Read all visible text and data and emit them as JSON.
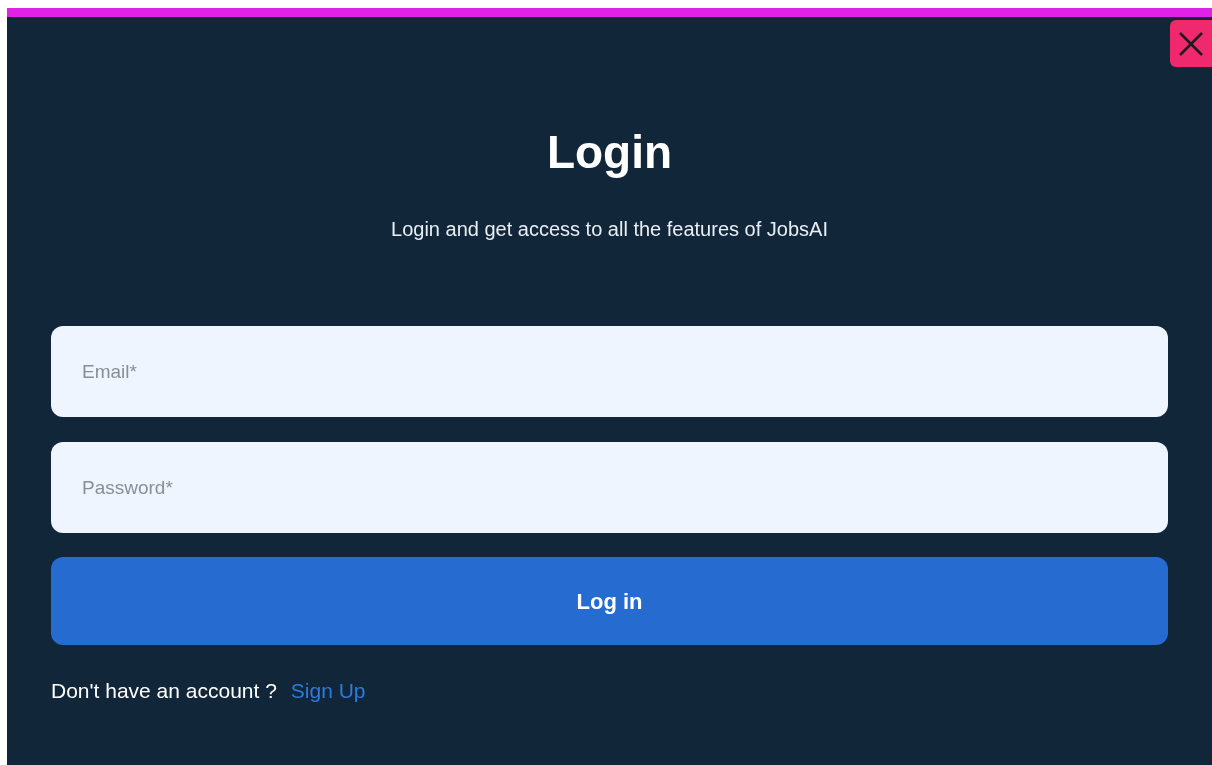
{
  "dialog": {
    "title": "Login",
    "subtitle": "Login and get access to all the features of JobsAI"
  },
  "fields": [
    {
      "placeholder": "Email*"
    },
    {
      "placeholder": "Password*"
    }
  ],
  "submit": "Log in",
  "footer": {
    "text": "Don't have an account ?",
    "link": "Sign Up"
  }
}
